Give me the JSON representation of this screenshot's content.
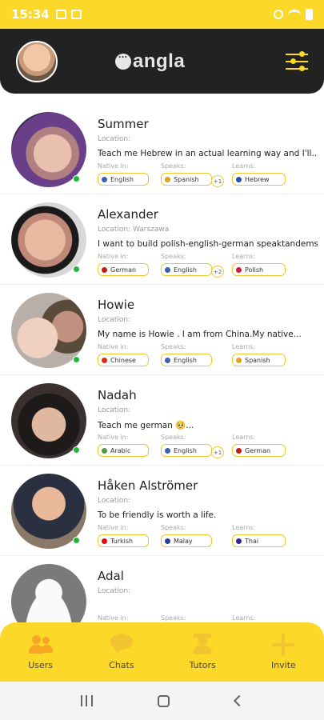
{
  "status_bar": {
    "time": "15:34"
  },
  "header": {
    "app_name": "angla"
  },
  "labels": {
    "native": "Native in:",
    "speaks": "Speaks:",
    "learns": "Learns:"
  },
  "users": [
    {
      "name": "Summer",
      "location": "Location:",
      "bio": "Teach me Hebrew in an actual learning way and I'll...",
      "native": "English",
      "native_flag": "#3c5fb0",
      "speaks": "Spanish",
      "speaks_flag": "#e0a020",
      "speaks_more": "+1",
      "learns": "Hebrew",
      "learns_flag": "#2a4fa8"
    },
    {
      "name": "Alexander",
      "location": "Location: Warszawa",
      "bio": "I want to build polish-english-german speaktandems ;-)",
      "native": "German",
      "native_flag": "#c81818",
      "speaks": "English",
      "speaks_flag": "#3c5fb0",
      "speaks_more": "+2",
      "learns": "Polish",
      "learns_flag": "#dc143c"
    },
    {
      "name": "Howie",
      "location": "Location:",
      "bio": "My name is Howie . I am from China.My native...",
      "native": "Chinese",
      "native_flag": "#de2910",
      "speaks": "English",
      "speaks_flag": "#3c5fb0",
      "speaks_more": "",
      "learns": "Spanish",
      "learns_flag": "#e0a020"
    },
    {
      "name": "Nadah",
      "location": "Location:",
      "bio": "Teach me german 🥺...",
      "native": "Arabic",
      "native_flag": "#4a9e3a",
      "speaks": "English",
      "speaks_flag": "#3c5fb0",
      "speaks_more": "+1",
      "learns": "German",
      "learns_flag": "#c81818"
    },
    {
      "name": "Håken Alströmer",
      "location": "Location:",
      "bio": "To be friendly is worth a life.",
      "native": "Turkish",
      "native_flag": "#e30a17",
      "speaks": "Malay",
      "speaks_flag": "#2a3f9a",
      "speaks_more": "",
      "learns": "Thai",
      "learns_flag": "#2d2a8a"
    },
    {
      "name": "Adal",
      "location": "Location:",
      "bio": "",
      "native": "",
      "native_flag": "",
      "speaks": "",
      "speaks_flag": "",
      "speaks_more": "",
      "learns": "",
      "learns_flag": ""
    }
  ],
  "bottom_nav": [
    {
      "label": "Users",
      "icon": "users-icon"
    },
    {
      "label": "Chats",
      "icon": "chat-icon"
    },
    {
      "label": "Tutors",
      "icon": "tutor-icon"
    },
    {
      "label": "Invite",
      "icon": "plus-icon"
    }
  ],
  "colors": {
    "accent": "#fcd829",
    "header_bg": "#222222",
    "online": "#21b53a"
  }
}
